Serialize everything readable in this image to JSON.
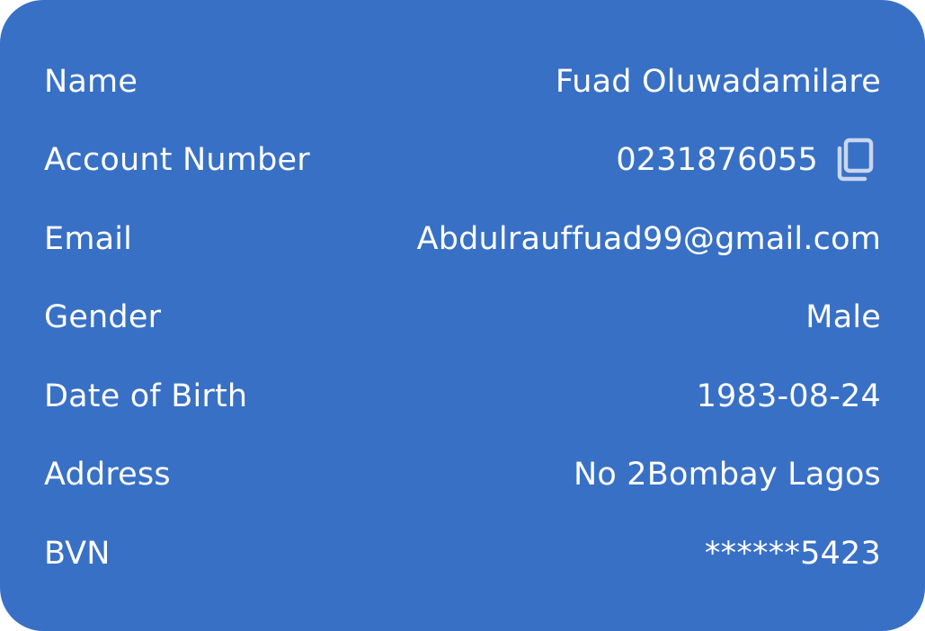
{
  "details": {
    "rows": [
      {
        "label": "Name",
        "value": "Fuad Oluwadamilare"
      },
      {
        "label": "Account Number",
        "value": "0231876055"
      },
      {
        "label": "Email",
        "value": "Abdulrauffuad99@gmail.com"
      },
      {
        "label": "Gender",
        "value": "Male"
      },
      {
        "label": "Date of Birth",
        "value": "1983-08-24"
      },
      {
        "label": "Address",
        "value": "No 2Bombay Lagos"
      },
      {
        "label": "BVN",
        "value": "******5423"
      }
    ],
    "copy_icon": "copy-icon"
  },
  "colors": {
    "card_background": "#3870C6",
    "text": "#FFFFFF",
    "icon": "#C9D6EE"
  }
}
